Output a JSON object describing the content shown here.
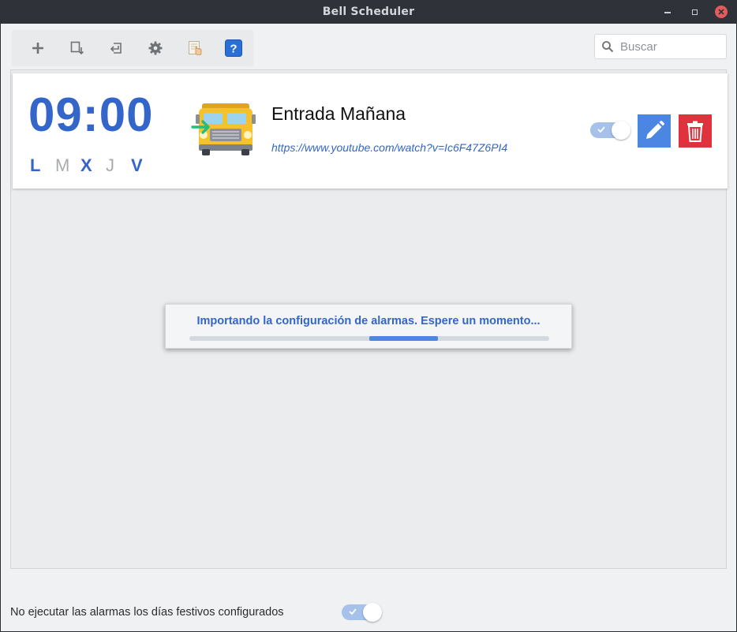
{
  "window": {
    "title": "Bell Scheduler"
  },
  "toolbar": {
    "buttons": [
      {
        "name": "add-alarm-button",
        "icon": "plus-icon"
      },
      {
        "name": "export-button",
        "icon": "export-icon"
      },
      {
        "name": "import-button",
        "icon": "import-icon"
      },
      {
        "name": "settings-button",
        "icon": "gear-icon"
      },
      {
        "name": "holidays-button",
        "icon": "calendar-hand-icon"
      },
      {
        "name": "help-button",
        "icon": "help-icon"
      }
    ]
  },
  "search": {
    "placeholder": "Buscar",
    "value": ""
  },
  "alarm": {
    "time": "09:00",
    "days": [
      {
        "label": "L",
        "active": true
      },
      {
        "label": "M",
        "active": false
      },
      {
        "label": "X",
        "active": true
      },
      {
        "label": "J",
        "active": false
      },
      {
        "label": "V",
        "active": true
      }
    ],
    "name": "Entrada Mañana",
    "url": "https://www.youtube.com/watch?v=Ic6F47Z6PI4",
    "enabled": true,
    "icon": "school-bus-entry-icon"
  },
  "dialog": {
    "message": "Importando la configuración de alarmas. Espere un momento...",
    "progress_start": 0.5,
    "progress_end": 0.69
  },
  "footer": {
    "holidays_label": "No ejecutar las alarmas los días festivos configurados",
    "holidays_enabled": true
  },
  "colors": {
    "accent": "#3465c9",
    "edit": "#4a86e2",
    "delete": "#e0323c",
    "toggle_track": "#a6c2ea"
  }
}
